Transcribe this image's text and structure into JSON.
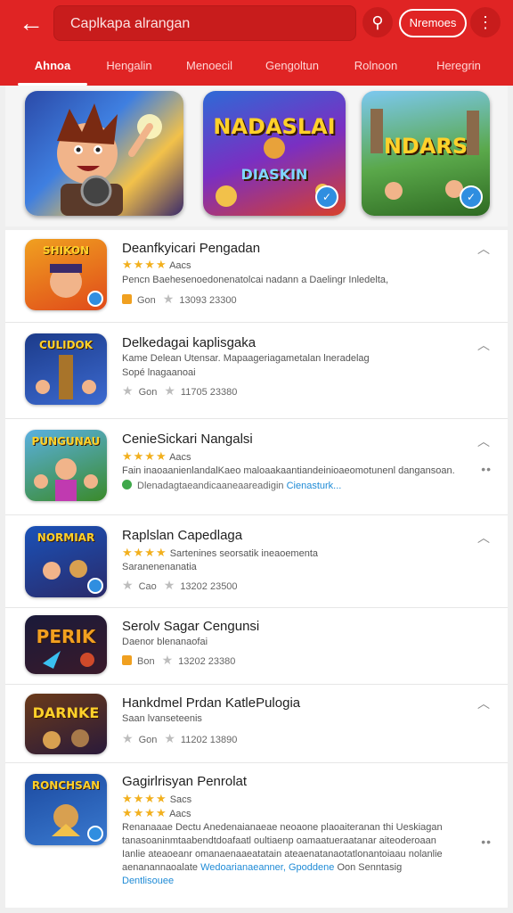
{
  "topbar": {
    "search_text": "Caplkapa alrangan",
    "pill_label": "Nremoes",
    "back_icon": "arrow-left-icon",
    "search_icon": "search-icon",
    "more_icon": "more-vertical-icon",
    "accent": "#e02424"
  },
  "tabs": [
    "Ahnoa",
    "Hengalin",
    "Menoecil",
    "Gengoltun",
    "Rolnoon",
    "Heregrin"
  ],
  "featured": [
    {
      "label": "",
      "bg": "#2b4aa8"
    },
    {
      "label": "NADASLAI",
      "sub": "DIASKIN",
      "bg": "#6a2bb0"
    },
    {
      "label": "NDARS",
      "bg": "#3d7e33"
    }
  ],
  "items": [
    {
      "title": "Deanfkyicari Pengadan",
      "icon_label": "SHIKON",
      "icon_bg": "#e86a1a",
      "stars": "★★★★",
      "stars_text": "Aacs",
      "desc": "Pencn Baehesenoedonenatolcai nadann a Daelingr Inledelta,",
      "meta_text": "Gon",
      "meta_num": "13093 23300",
      "meta_badge": "orange"
    },
    {
      "title": "Delkedagai kaplisgaka",
      "icon_label": "CULIDOK",
      "icon_bg": "#1c3b8a",
      "line1": "Kame Delean Utensar. Mapaageriagametalan lneradelag",
      "line2": "Sopé lnagaanoai",
      "meta_text": "Gon",
      "meta_num": "11705 23380",
      "meta_badge": "grey"
    },
    {
      "title": "CenieSickari Nangalsi",
      "icon_label": "PUNGUNAU",
      "icon_bg": "#4a8a2a",
      "stars": "★★★★",
      "stars_text": "Aacs",
      "desc": "Fain inaoaanienlandalKaeo maloaakaantiandeinioaeomotunenl dangansoan.",
      "desc2": "Dlenadagtaeandicaaneaareadigin",
      "link": "Cienasturk...",
      "meta_badge": "green",
      "has_more": true
    },
    {
      "title": "Raplslan Capedlaga",
      "icon_label": "NORMIAR",
      "icon_bg": "#1a52b8",
      "stars": "★★★★",
      "stars_text": "Sartenines seorsatik ineaoementa",
      "line1": "Saranenenanatia",
      "meta_text": "Cao",
      "meta_num": "13202 23500",
      "meta_badge": "grey"
    },
    {
      "title": "Serolv Sagar Cengunsi",
      "icon_label": "PERIK",
      "icon_bg": "#1a1a3a",
      "line1": "Daenor blenanaofai",
      "meta_text": "Bon",
      "meta_num": "13202 23380",
      "meta_badge": "orange",
      "no_chevron": true
    },
    {
      "title": "Hankdmel Prdan KatlePulogia",
      "icon_label": "DARNKE",
      "icon_bg": "#6a3a1a",
      "line1": "Saan lvanseteenis",
      "meta_text": "Gon",
      "meta_num": "11202 13890",
      "meta_badge": "grey"
    },
    {
      "title": "Gagirlrisyan Penrolat",
      "icon_label": "RONCHSAN",
      "icon_bg": "#1c4aa0",
      "stars": "★★★★",
      "stars_text": "Sacs",
      "stars2_text": "Aacs",
      "desc_lines": [
        "Renanaaae Dectu Anedenaianaeae neoaone plaoaiteranan thi Ueskiagan",
        "tanasoaninmtaabendtdoafaatl oultiaenp oamaatueraatanar aiteoderoaan",
        "Ianlie ateaoeanr omanaenaaeatatain ateaenatanaotatlonantoiaau nolanlie",
        "aenanannaoalate"
      ],
      "inline_link": "Wedoarianaeanner,",
      "link2": "Gpoddene",
      "tail": "Oon Senntasig",
      "footer_link": "Dentlisouee",
      "has_more": true,
      "no_chevron": true
    }
  ]
}
